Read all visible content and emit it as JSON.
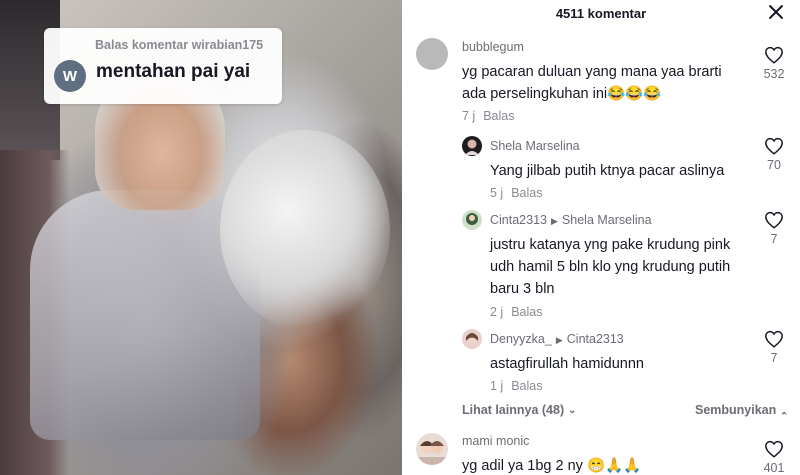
{
  "video": {
    "reply_label": "Balas komentar wirabian175",
    "reply_avatar_letter": "W",
    "reply_text": "mentahan pai yai"
  },
  "header": {
    "title": "4511 komentar"
  },
  "comments": [
    {
      "user": "bubblegum",
      "text": "yg pacaran duluan yang mana yaa brarti ada perselingkuhan ini😂😂😂",
      "time": "7 j",
      "reply_label": "Balas",
      "likes": "532"
    },
    {
      "user": "Shela Marselina",
      "text": "Yang jilbab putih ktnya pacar aslinya",
      "time": "5 j",
      "reply_label": "Balas",
      "likes": "70"
    },
    {
      "user": "Cinta2313",
      "reply_to": "Shela Marselina",
      "text": "justru katanya yng pake krudung pink udh hamil 5 bln klo yng krudung putih baru 3 bln",
      "time": "2 j",
      "reply_label": "Balas",
      "likes": "7"
    },
    {
      "user": "Denyyzka_",
      "reply_to": "Cinta2313",
      "text": "astagfirullah hamidunnn",
      "time": "1 j",
      "reply_label": "Balas",
      "likes": "7"
    },
    {
      "user": "mami monic",
      "text": "yg adil ya 1bg 2 ny 😁🙏🙏",
      "likes": "401"
    }
  ],
  "thread_controls": {
    "more_label": "Lihat lainnya (48)",
    "hide_label": "Sembunyikan"
  },
  "icons": {
    "close": "close-icon",
    "like": "heart-outline-icon",
    "chevron": "chevron-down-icon"
  }
}
